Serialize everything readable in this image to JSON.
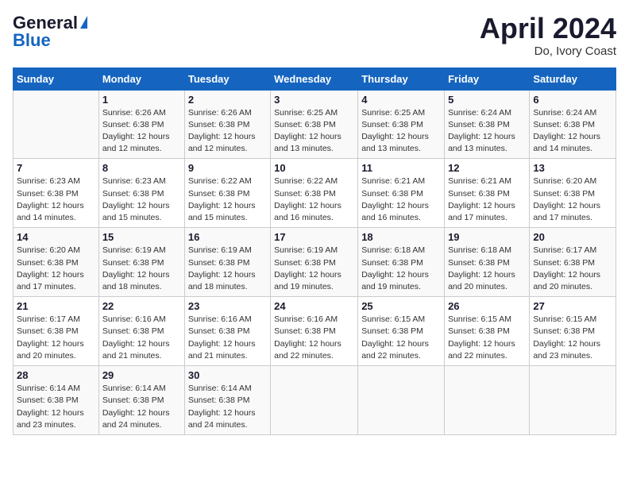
{
  "header": {
    "logo_line1": "General",
    "logo_line2": "Blue",
    "month": "April 2024",
    "location": "Do, Ivory Coast"
  },
  "weekdays": [
    "Sunday",
    "Monday",
    "Tuesday",
    "Wednesday",
    "Thursday",
    "Friday",
    "Saturday"
  ],
  "weeks": [
    [
      {
        "day": "",
        "info": ""
      },
      {
        "day": "1",
        "info": "Sunrise: 6:26 AM\nSunset: 6:38 PM\nDaylight: 12 hours\nand 12 minutes."
      },
      {
        "day": "2",
        "info": "Sunrise: 6:26 AM\nSunset: 6:38 PM\nDaylight: 12 hours\nand 12 minutes."
      },
      {
        "day": "3",
        "info": "Sunrise: 6:25 AM\nSunset: 6:38 PM\nDaylight: 12 hours\nand 13 minutes."
      },
      {
        "day": "4",
        "info": "Sunrise: 6:25 AM\nSunset: 6:38 PM\nDaylight: 12 hours\nand 13 minutes."
      },
      {
        "day": "5",
        "info": "Sunrise: 6:24 AM\nSunset: 6:38 PM\nDaylight: 12 hours\nand 13 minutes."
      },
      {
        "day": "6",
        "info": "Sunrise: 6:24 AM\nSunset: 6:38 PM\nDaylight: 12 hours\nand 14 minutes."
      }
    ],
    [
      {
        "day": "7",
        "info": "Sunrise: 6:23 AM\nSunset: 6:38 PM\nDaylight: 12 hours\nand 14 minutes."
      },
      {
        "day": "8",
        "info": "Sunrise: 6:23 AM\nSunset: 6:38 PM\nDaylight: 12 hours\nand 15 minutes."
      },
      {
        "day": "9",
        "info": "Sunrise: 6:22 AM\nSunset: 6:38 PM\nDaylight: 12 hours\nand 15 minutes."
      },
      {
        "day": "10",
        "info": "Sunrise: 6:22 AM\nSunset: 6:38 PM\nDaylight: 12 hours\nand 16 minutes."
      },
      {
        "day": "11",
        "info": "Sunrise: 6:21 AM\nSunset: 6:38 PM\nDaylight: 12 hours\nand 16 minutes."
      },
      {
        "day": "12",
        "info": "Sunrise: 6:21 AM\nSunset: 6:38 PM\nDaylight: 12 hours\nand 17 minutes."
      },
      {
        "day": "13",
        "info": "Sunrise: 6:20 AM\nSunset: 6:38 PM\nDaylight: 12 hours\nand 17 minutes."
      }
    ],
    [
      {
        "day": "14",
        "info": "Sunrise: 6:20 AM\nSunset: 6:38 PM\nDaylight: 12 hours\nand 17 minutes."
      },
      {
        "day": "15",
        "info": "Sunrise: 6:19 AM\nSunset: 6:38 PM\nDaylight: 12 hours\nand 18 minutes."
      },
      {
        "day": "16",
        "info": "Sunrise: 6:19 AM\nSunset: 6:38 PM\nDaylight: 12 hours\nand 18 minutes."
      },
      {
        "day": "17",
        "info": "Sunrise: 6:19 AM\nSunset: 6:38 PM\nDaylight: 12 hours\nand 19 minutes."
      },
      {
        "day": "18",
        "info": "Sunrise: 6:18 AM\nSunset: 6:38 PM\nDaylight: 12 hours\nand 19 minutes."
      },
      {
        "day": "19",
        "info": "Sunrise: 6:18 AM\nSunset: 6:38 PM\nDaylight: 12 hours\nand 20 minutes."
      },
      {
        "day": "20",
        "info": "Sunrise: 6:17 AM\nSunset: 6:38 PM\nDaylight: 12 hours\nand 20 minutes."
      }
    ],
    [
      {
        "day": "21",
        "info": "Sunrise: 6:17 AM\nSunset: 6:38 PM\nDaylight: 12 hours\nand 20 minutes."
      },
      {
        "day": "22",
        "info": "Sunrise: 6:16 AM\nSunset: 6:38 PM\nDaylight: 12 hours\nand 21 minutes."
      },
      {
        "day": "23",
        "info": "Sunrise: 6:16 AM\nSunset: 6:38 PM\nDaylight: 12 hours\nand 21 minutes."
      },
      {
        "day": "24",
        "info": "Sunrise: 6:16 AM\nSunset: 6:38 PM\nDaylight: 12 hours\nand 22 minutes."
      },
      {
        "day": "25",
        "info": "Sunrise: 6:15 AM\nSunset: 6:38 PM\nDaylight: 12 hours\nand 22 minutes."
      },
      {
        "day": "26",
        "info": "Sunrise: 6:15 AM\nSunset: 6:38 PM\nDaylight: 12 hours\nand 22 minutes."
      },
      {
        "day": "27",
        "info": "Sunrise: 6:15 AM\nSunset: 6:38 PM\nDaylight: 12 hours\nand 23 minutes."
      }
    ],
    [
      {
        "day": "28",
        "info": "Sunrise: 6:14 AM\nSunset: 6:38 PM\nDaylight: 12 hours\nand 23 minutes."
      },
      {
        "day": "29",
        "info": "Sunrise: 6:14 AM\nSunset: 6:38 PM\nDaylight: 12 hours\nand 24 minutes."
      },
      {
        "day": "30",
        "info": "Sunrise: 6:14 AM\nSunset: 6:38 PM\nDaylight: 12 hours\nand 24 minutes."
      },
      {
        "day": "",
        "info": ""
      },
      {
        "day": "",
        "info": ""
      },
      {
        "day": "",
        "info": ""
      },
      {
        "day": "",
        "info": ""
      }
    ]
  ]
}
